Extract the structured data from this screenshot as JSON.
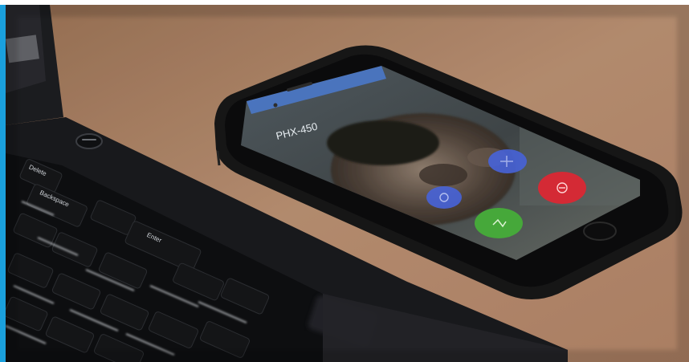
{
  "phone": {
    "call_label": "PHX-450",
    "colors": {
      "accept": "#46a83a",
      "decline": "#d42a35",
      "option": "#4763d8",
      "status_bar": "#4a78c9"
    },
    "call_buttons": [
      {
        "name": "video-call-button",
        "color": "#4763d8"
      },
      {
        "name": "mute-call-button",
        "color": "#4763d8"
      },
      {
        "name": "decline-call-button",
        "color": "#d42a35"
      },
      {
        "name": "accept-call-button",
        "color": "#46a83a"
      }
    ]
  },
  "laptop": {
    "keys": [
      "Delete",
      "Backspace",
      "Enter"
    ]
  },
  "accent_bar_color": "#1aa0dd"
}
